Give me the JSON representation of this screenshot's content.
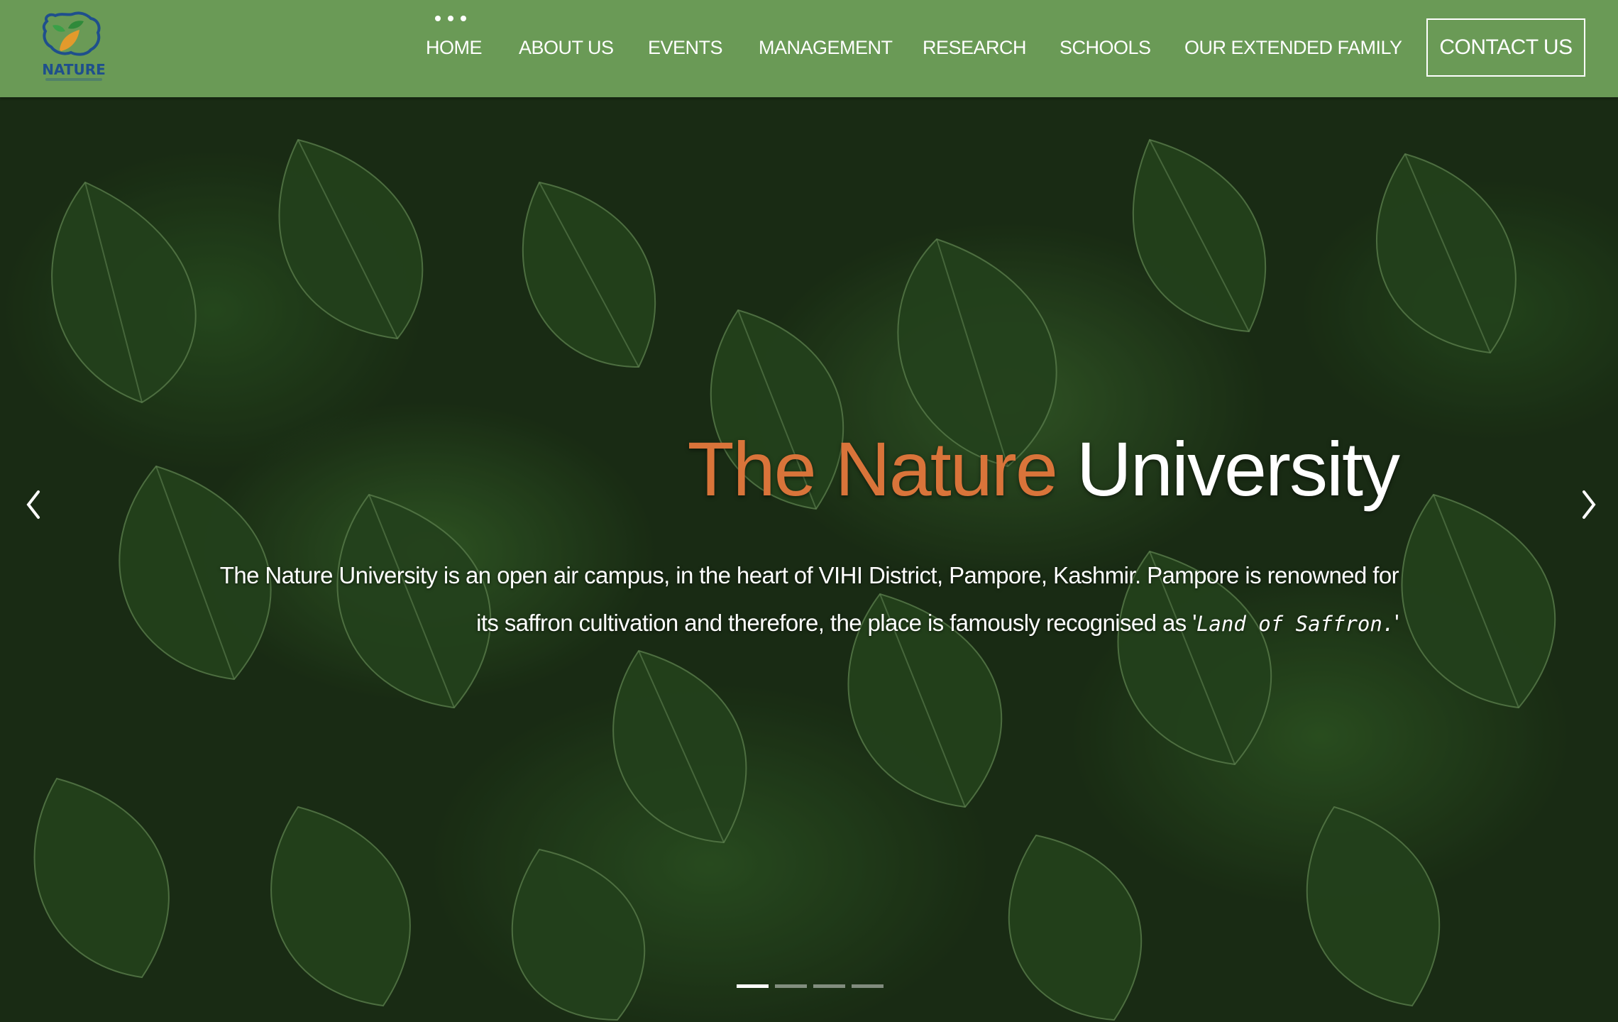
{
  "logo": {
    "text": "NATURE",
    "icon": "nature-university-logo"
  },
  "nav": {
    "items": [
      {
        "label": "HOME",
        "active": true
      },
      {
        "label": "ABOUT US"
      },
      {
        "label": "EVENTS"
      },
      {
        "label": "MANAGEMENT"
      },
      {
        "label": "RESEARCH"
      },
      {
        "label": "SCHOOLS"
      },
      {
        "label": "OUR EXTENDED FAMILY"
      }
    ],
    "contact_label": "CONTACT US",
    "bar_color": "#6a9a56"
  },
  "hero": {
    "title_accent": "The Nature",
    "title_rest": "University",
    "accent_color": "#d9743a",
    "description_main": "The Nature University is an open air campus, in the heart of VIHI District, Pampore, Kashmir. Pampore is renowned for its saffron cultivation and therefore, the place is famously recognised as '",
    "description_emph": "Land of Saffron.",
    "description_end": "'",
    "prev_icon": "chevron-left-icon",
    "next_icon": "chevron-right-icon",
    "slides": {
      "count": 4,
      "active": 1
    }
  }
}
